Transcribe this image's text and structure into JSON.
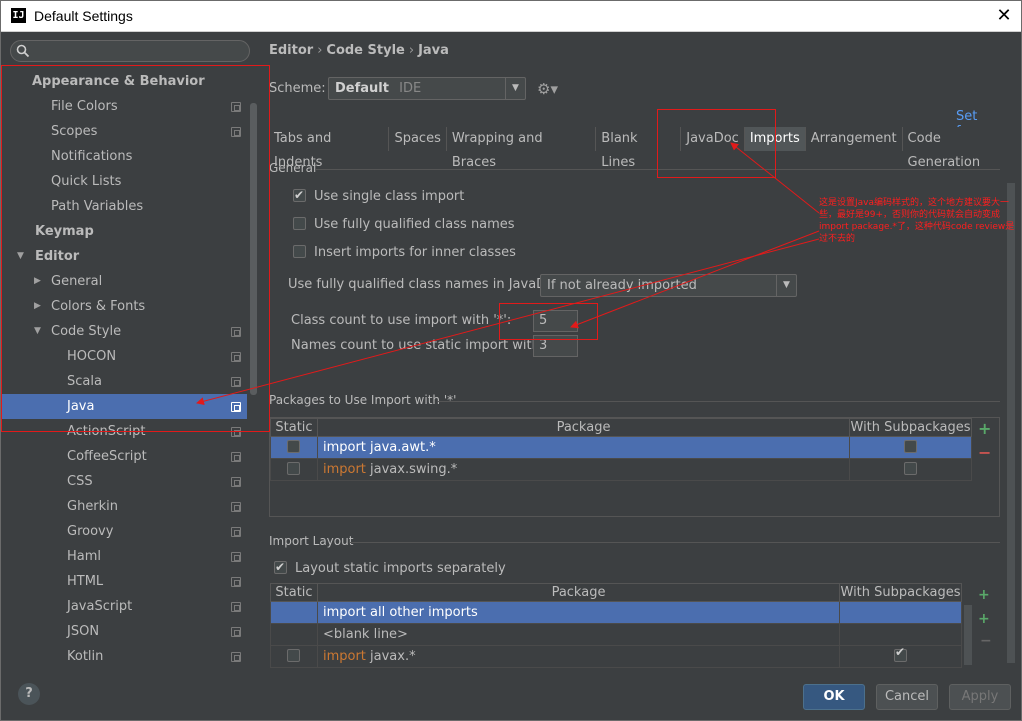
{
  "window": {
    "title": "Default Settings",
    "app_icon": "IJ",
    "close_glyph": "✕"
  },
  "sidebar": {
    "search_placeholder": "",
    "items": [
      {
        "label": "Appearance & Behavior"
      },
      {
        "label": "File Colors"
      },
      {
        "label": "Scopes"
      },
      {
        "label": "Notifications"
      },
      {
        "label": "Quick Lists"
      },
      {
        "label": "Path Variables"
      },
      {
        "label": "Keymap"
      },
      {
        "label": "Editor"
      },
      {
        "label": "General"
      },
      {
        "label": "Colors & Fonts"
      },
      {
        "label": "Code Style"
      },
      {
        "label": "HOCON"
      },
      {
        "label": "Scala"
      },
      {
        "label": "Java"
      },
      {
        "label": "ActionScript"
      },
      {
        "label": "CoffeeScript"
      },
      {
        "label": "CSS"
      },
      {
        "label": "Gherkin"
      },
      {
        "label": "Groovy"
      },
      {
        "label": "Haml"
      },
      {
        "label": "HTML"
      },
      {
        "label": "JavaScript"
      },
      {
        "label": "JSON"
      },
      {
        "label": "Kotlin"
      }
    ]
  },
  "breadcrumb": {
    "part1": "Editor",
    "part2": "Code Style",
    "part3": "Java",
    "sep": "›"
  },
  "scheme": {
    "label": "Scheme:",
    "value": "Default",
    "suffix": "IDE"
  },
  "set_from": "Set from...",
  "tabs": [
    "Tabs and Indents",
    "Spaces",
    "Wrapping and Braces",
    "Blank Lines",
    "JavaDoc",
    "Imports",
    "Arrangement",
    "Code Generation"
  ],
  "active_tab": "Imports",
  "general": {
    "title": "General",
    "single_class_import": "Use single class import",
    "fully_qualified": "Use fully qualified class names",
    "inner_classes": "Insert imports for inner classes",
    "javadoc_label": "Use fully qualified class names in JavaDoc:",
    "javadoc_value": "If not already imported",
    "class_count_label": "Class count to use import with '*':",
    "class_count_value": "5",
    "static_count_label": "Names count to use static import with '*':",
    "static_count_value": "3"
  },
  "packages": {
    "title": "Packages to Use Import with '*'",
    "headers": [
      "Static",
      "Package",
      "With Subpackages"
    ],
    "rows": [
      {
        "kw": "import",
        "pkg": " java.awt.*"
      },
      {
        "kw": "import",
        "pkg": " javax.swing.*"
      }
    ]
  },
  "import_layout": {
    "title": "Import Layout",
    "static_separately": "Layout static imports separately",
    "headers": [
      "Static",
      "Package",
      "With Subpackages"
    ],
    "rows": [
      {
        "pkg": "import all other imports"
      },
      {
        "pkg": "<blank line>"
      },
      {
        "kw": "import",
        "pkg": " javax.*"
      }
    ]
  },
  "annotation": "这是设置Java编码样式的，这个地方建议要大一些，最好是99+，否则你的代码就会自动变成import package.*了，这种代码code review是过不去的",
  "buttons": {
    "help": "?",
    "ok": "OK",
    "cancel": "Cancel",
    "apply": "Apply"
  },
  "colors": {
    "selection": "#4b6eaf",
    "keyword": "#cc7832",
    "link": "#589df6",
    "annotation": "#ff1e1e"
  }
}
